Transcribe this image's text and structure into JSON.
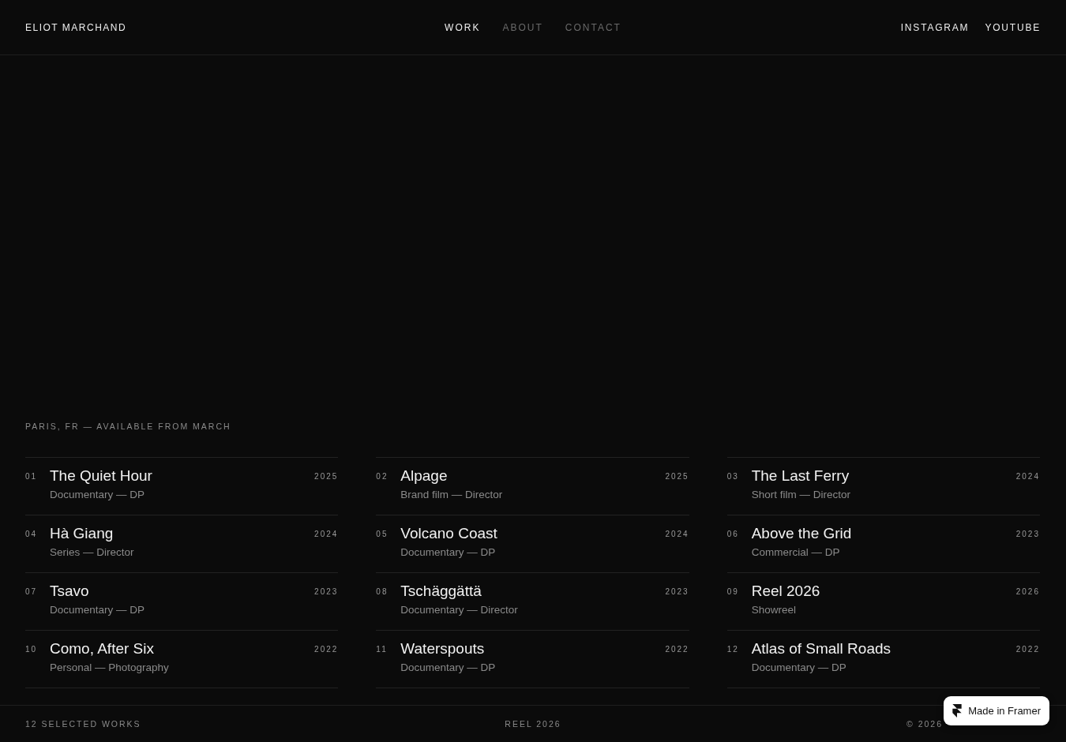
{
  "header": {
    "name": "ELIOT MARCHAND",
    "nav": [
      {
        "label": "WORK",
        "selected": true
      },
      {
        "label": "ABOUT",
        "selected": false
      },
      {
        "label": "CONTACT",
        "selected": false
      }
    ],
    "social": [
      "INSTAGRAM",
      "YOUTUBE"
    ]
  },
  "tagline": "PARIS, FR — AVAILABLE FROM MARCH",
  "works": [
    {
      "number": "01",
      "title": "The Quiet Hour",
      "meta": "Documentary — DP",
      "year": "2025"
    },
    {
      "number": "02",
      "title": "Alpage",
      "meta": "Brand film — Director",
      "year": "2025"
    },
    {
      "number": "03",
      "title": "The Last Ferry",
      "meta": "Short film — Director",
      "year": "2024"
    },
    {
      "number": "04",
      "title": "Hà Giang",
      "meta": "Series — Director",
      "year": "2024"
    },
    {
      "number": "05",
      "title": "Volcano Coast",
      "meta": "Documentary — DP",
      "year": "2024"
    },
    {
      "number": "06",
      "title": "Above the Grid",
      "meta": "Commercial — DP",
      "year": "2023"
    },
    {
      "number": "07",
      "title": "Tsavo",
      "meta": "Documentary — DP",
      "year": "2023"
    },
    {
      "number": "08",
      "title": "Tschäggättä",
      "meta": "Documentary — Director",
      "year": "2023"
    },
    {
      "number": "09",
      "title": "Reel 2026",
      "meta": "Showreel",
      "year": "2026"
    },
    {
      "number": "10",
      "title": "Como, After Six",
      "meta": "Personal — Photography",
      "year": "2022"
    },
    {
      "number": "11",
      "title": "Waterspouts",
      "meta": "Documentary — DP",
      "year": "2022"
    },
    {
      "number": "12",
      "title": "Atlas of Small Roads",
      "meta": "Documentary — DP",
      "year": "2022"
    }
  ],
  "footer": {
    "count": "12 SELECTED WORKS",
    "reel": "REEL 2026",
    "copyright": "© 2026"
  },
  "badge": "Made in Framer"
}
